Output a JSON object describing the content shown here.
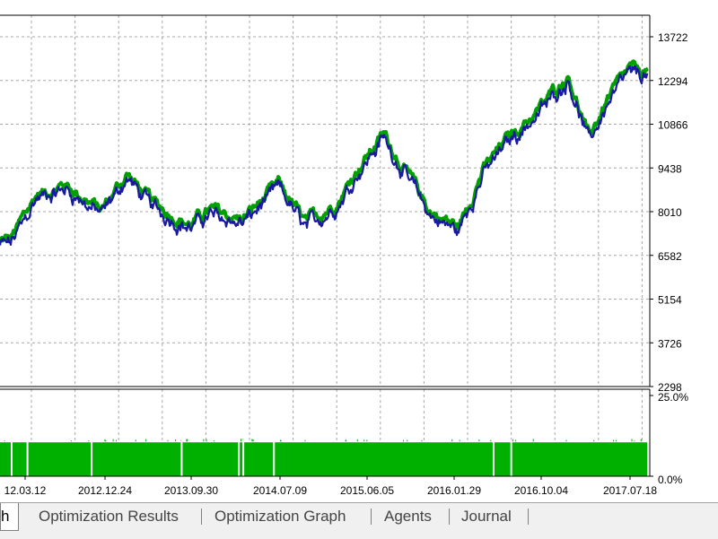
{
  "colors": {
    "balance": "#00a000",
    "equity": "#1a1aa0",
    "grid": "#a8a8a8",
    "deposit_load": "#00b000"
  },
  "chart_data": [
    {
      "type": "line",
      "title": "",
      "x": [
        "2011.12.01",
        "2012.03.12",
        "2012.06.01",
        "2012.09.01",
        "2012.12.24",
        "2013.03.15",
        "2013.06.01",
        "2013.09.30",
        "2013.12.01",
        "2014.03.15",
        "2014.07.09",
        "2014.10.01",
        "2015.01.10",
        "2015.03.20",
        "2015.06.05",
        "2015.08.25",
        "2015.11.01",
        "2016.01.29",
        "2016.04.10",
        "2016.07.01",
        "2016.10.04",
        "2017.01.10",
        "2017.03.15",
        "2017.05.15",
        "2017.07.18"
      ],
      "series": [
        {
          "name": "",
          "values": [
            6950,
            7100,
            8550,
            8900,
            8050,
            9250,
            8300,
            7600,
            8050,
            7750,
            8900,
            7600,
            8350,
            9500,
            10550,
            9150,
            8000,
            7500,
            9300,
            10400,
            11300,
            12500,
            10400,
            11700,
            12600
          ]
        }
      ],
      "x_ticks": [
        "12.03.12",
        "2012.12.24",
        "2013.09.30",
        "2014.07.09",
        "2015.06.05",
        "2016.01.29",
        "2016.10.04",
        "2017.07.18"
      ],
      "y_ticks": [
        "13722",
        "12294",
        "10866",
        "9438",
        "8010",
        "6582",
        "5154",
        "3726",
        "2298"
      ],
      "ylim": [
        2298,
        14300
      ]
    },
    {
      "type": "bar",
      "y_ticks": [
        "25.0%",
        "0.0%"
      ],
      "ylim": [
        0,
        25
      ],
      "level": 10.5,
      "gaps": [
        "2012.03.12",
        "2012.05.01",
        "2012.11.20",
        "2013.09.01",
        "2014.03.01",
        "2014.03.15",
        "2014.06.20",
        "2016.05.15",
        "2016.07.10"
      ]
    }
  ],
  "tabs": [
    {
      "label": "h",
      "active": true
    },
    {
      "label": "Optimization Results",
      "active": false
    },
    {
      "label": "Optimization Graph",
      "active": false
    },
    {
      "label": "Agents",
      "active": false
    },
    {
      "label": "Journal",
      "active": false
    }
  ]
}
